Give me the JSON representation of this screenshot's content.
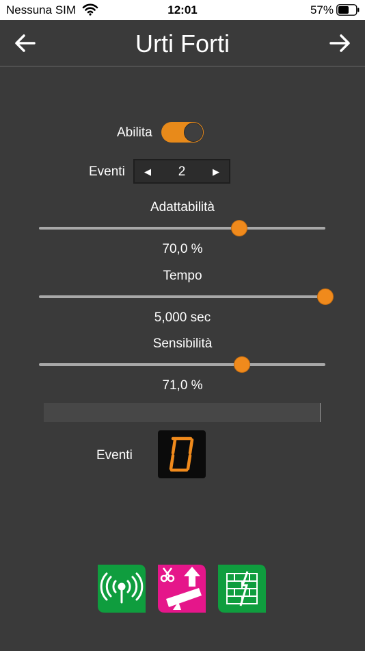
{
  "status_bar": {
    "carrier": "Nessuna SIM",
    "time": "12:01",
    "battery_percent": "57%"
  },
  "nav": {
    "title": "Urti Forti"
  },
  "settings": {
    "enable_label": "Abilita",
    "enable_on": true,
    "events_label": "Eventi",
    "events_value": "2",
    "adaptability_label": "Adattabilità",
    "adaptability_value_text": "70,0 %",
    "adaptability_fraction": 0.7,
    "time_label": "Tempo",
    "time_value_text": "5,000 sec",
    "time_fraction": 1.0,
    "sensitivity_label": "Sensibilità",
    "sensitivity_value_text": "71,0 %",
    "sensitivity_fraction": 0.71
  },
  "counter": {
    "label": "Eventi",
    "value": "0"
  },
  "colors": {
    "background": "#3a3a3a",
    "accent": "#f08a1c",
    "green_button": "#0f9d3e",
    "magenta_button": "#e5168a"
  },
  "bottom_buttons": [
    {
      "icon": "antenna-icon"
    },
    {
      "icon": "cut-lift-icon"
    },
    {
      "icon": "wall-icon"
    }
  ]
}
